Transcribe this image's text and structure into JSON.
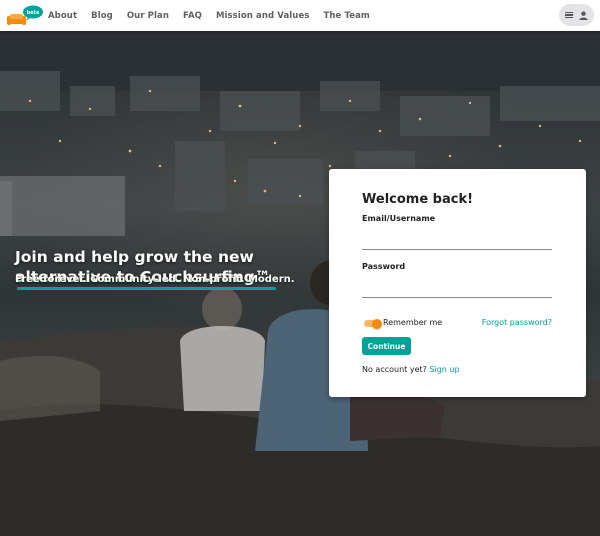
{
  "app": {
    "logo_badge": "beta"
  },
  "nav": {
    "items": [
      {
        "label": "About"
      },
      {
        "label": "Blog"
      },
      {
        "label": "Our Plan"
      },
      {
        "label": "FAQ"
      },
      {
        "label": "Mission and Values"
      },
      {
        "label": "The Team"
      }
    ]
  },
  "hero": {
    "title": "Join and help grow the new alternative to Couchsurfing™",
    "subtitle": "Free forever. Community-led. Non-profit. Modern."
  },
  "login": {
    "heading": "Welcome back!",
    "email_label": "Email/Username",
    "email_value": "",
    "password_label": "Password",
    "password_value": "",
    "remember_label": "Remember me",
    "remember_checked": true,
    "forgot_label": "Forgot password?",
    "continue_label": "Continue",
    "no_account_text": "No account yet? ",
    "signup_label": "Sign up"
  },
  "colors": {
    "accent_teal": "#00a398",
    "accent_orange": "#f58a0b",
    "nav_text": "#5f6064"
  },
  "icons": {
    "logo": "couch-logo-icon",
    "menu": "hamburger-icon",
    "user": "user-icon"
  }
}
